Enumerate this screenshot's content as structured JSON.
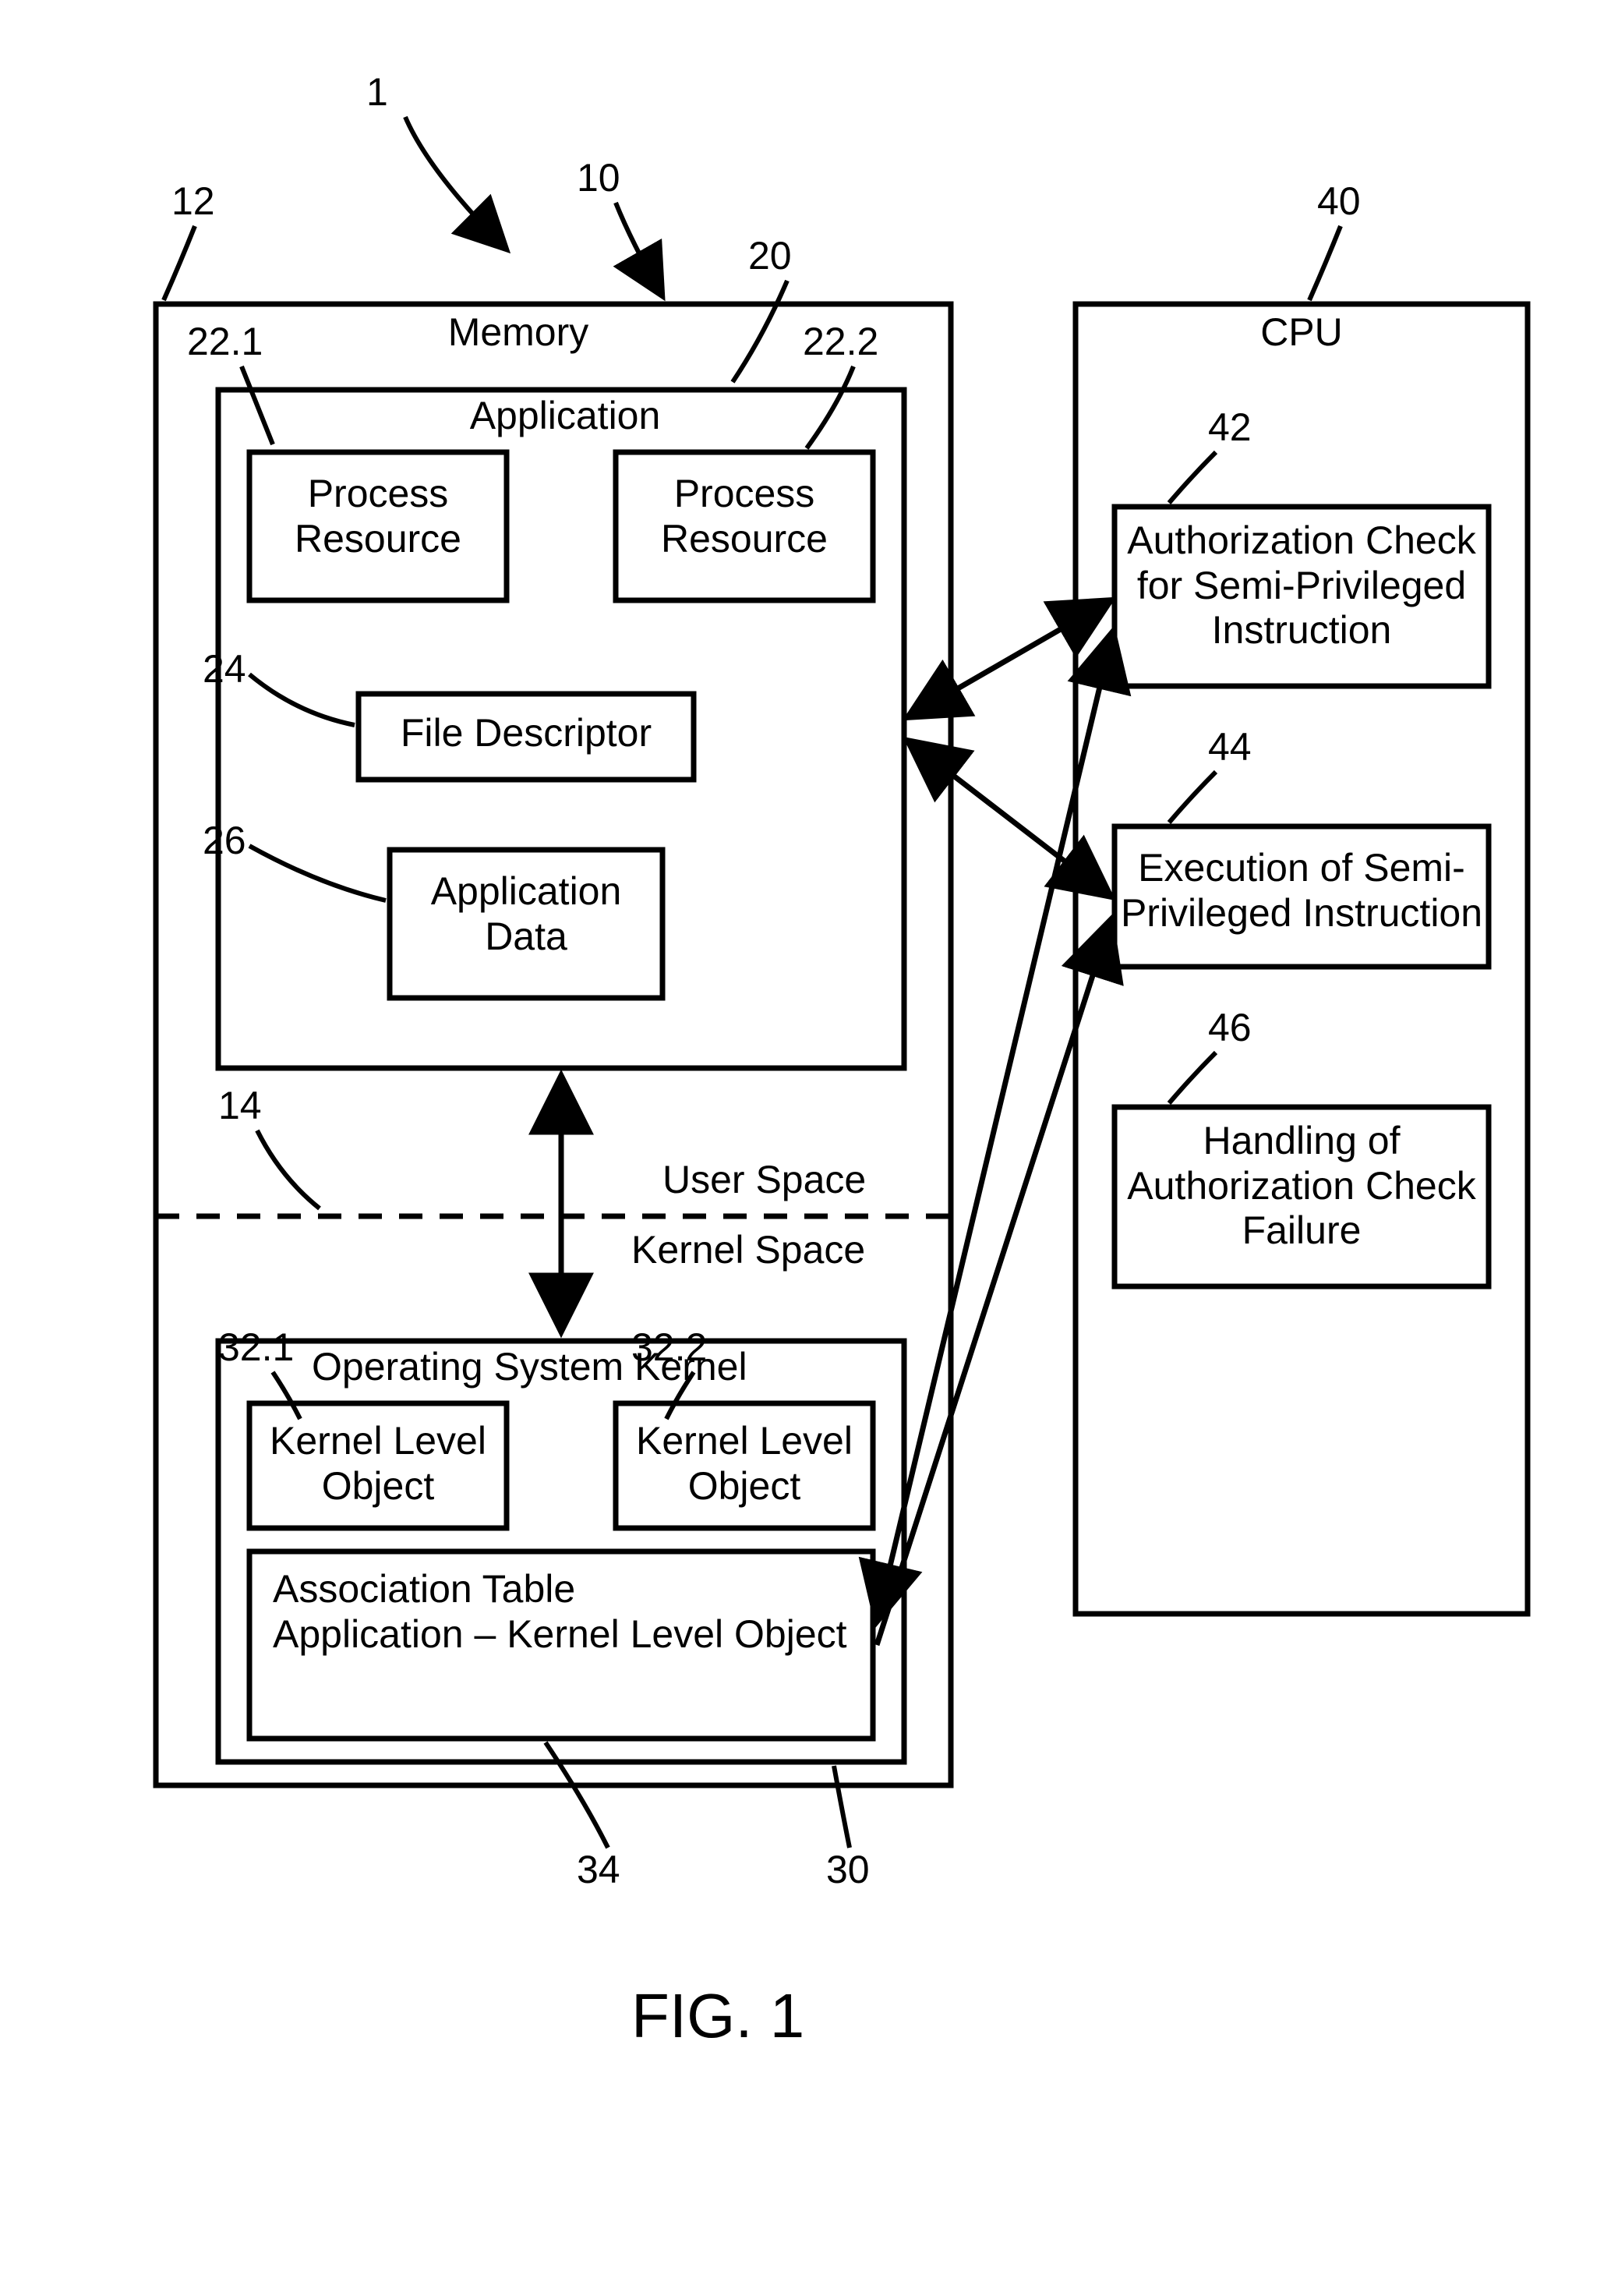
{
  "refs": {
    "r1": "1",
    "r10": "10",
    "r12": "12",
    "r14": "14",
    "r20": "20",
    "r22_1": "22.1",
    "r22_2": "22.2",
    "r24": "24",
    "r26": "26",
    "r30": "30",
    "r32_1": "32.1",
    "r32_2": "32.2",
    "r34": "34",
    "r40": "40",
    "r42": "42",
    "r44": "44",
    "r46": "46"
  },
  "labels": {
    "memory": "Memory",
    "application": "Application",
    "proc_res1": "Process\nResource",
    "proc_res2": "Process\nResource",
    "file_desc": "File Descriptor",
    "app_data": "Application\nData",
    "user_space": "User Space",
    "kernel_space": "Kernel Space",
    "os_kernel": "Operating System Kernel",
    "klo1": "Kernel Level\nObject",
    "klo2": "Kernel Level\nObject",
    "assoc_table": "Association Table\nApplication – Kernel Level Object",
    "cpu": "CPU",
    "auth_check": "Authorization Check\nfor Semi-Privileged\nInstruction",
    "exec_semi": "Execution of Semi-\nPrivileged Instruction",
    "handle_fail": "Handling of\nAuthorization Check\nFailure",
    "fig": "FIG. 1"
  }
}
